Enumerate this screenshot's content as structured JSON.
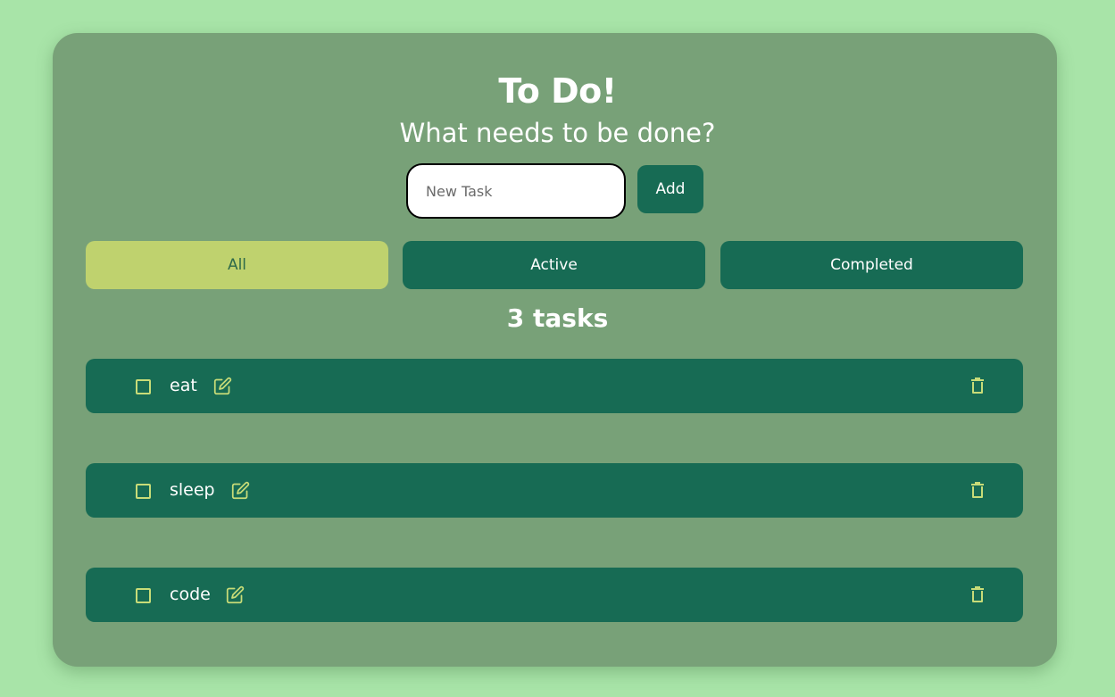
{
  "header": {
    "title": "To Do!",
    "subtitle": "What needs to be done?"
  },
  "new_task": {
    "placeholder": "New Task",
    "value": "",
    "add_label": "Add"
  },
  "filters": [
    {
      "label": "All",
      "selected": true
    },
    {
      "label": "Active",
      "selected": false
    },
    {
      "label": "Completed",
      "selected": false
    }
  ],
  "task_count": "3 tasks",
  "tasks": [
    {
      "label": "eat",
      "completed": false
    },
    {
      "label": "sleep",
      "completed": false
    },
    {
      "label": "code",
      "completed": false
    }
  ],
  "icons": {
    "edit": "edit-icon",
    "delete": "trash-icon"
  },
  "colors": {
    "page_background": "#a8e4a8",
    "card_background": "#78a178",
    "primary": "#176b54",
    "selected_filter": "#bfd26e",
    "icon_accent": "#c8dc78"
  }
}
